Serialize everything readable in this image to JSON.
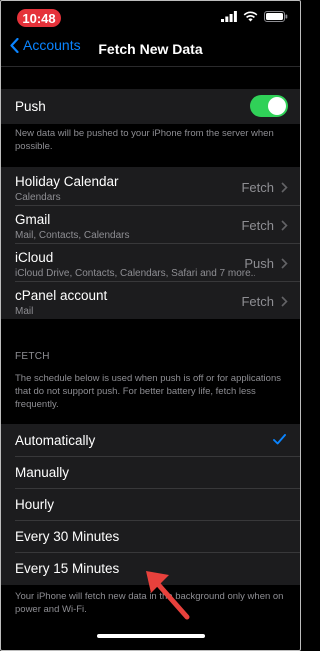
{
  "status_bar": {
    "time": "10:48"
  },
  "nav": {
    "back_label": "Accounts",
    "title": "Fetch New Data"
  },
  "push": {
    "label": "Push",
    "enabled": true,
    "description": "New data will be pushed to your iPhone from the server when possible."
  },
  "accounts": [
    {
      "name": "Holiday Calendar",
      "services": "Calendars",
      "value": "Fetch"
    },
    {
      "name": "Gmail",
      "services": "Mail, Contacts, Calendars",
      "value": "Fetch"
    },
    {
      "name": "iCloud",
      "services": "iCloud Drive, Contacts, Calendars, Safari and 7 more...",
      "value": "Push"
    },
    {
      "name": "cPanel account",
      "services": "Mail",
      "value": "Fetch"
    }
  ],
  "fetch": {
    "header": "FETCH",
    "description": "The schedule below is used when push is off or for applications that do not support push. For better battery life, fetch less frequently.",
    "options": [
      "Automatically",
      "Manually",
      "Hourly",
      "Every 30 Minutes",
      "Every 15 Minutes"
    ],
    "selected": "Automatically",
    "footer": "Your iPhone will fetch new data in the background only when on power and Wi-Fi."
  },
  "colors": {
    "accent": "#0a84ff",
    "toggle_on": "#30d158",
    "time_pill": "#e5323a",
    "annotation_arrow": "#e8413c"
  },
  "icons": [
    "signal-icon",
    "wifi-icon",
    "battery-icon",
    "chevron-left-icon",
    "chevron-right-icon",
    "checkmark-icon",
    "red-arrow-icon"
  ]
}
